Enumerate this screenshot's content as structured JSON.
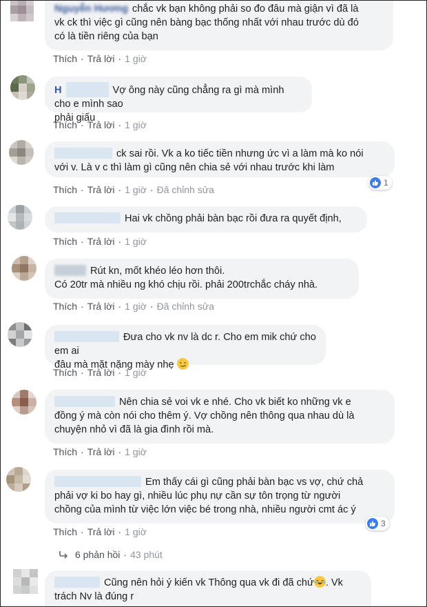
{
  "actions": {
    "like": "Thích",
    "reply": "Trả lời",
    "dot": "·",
    "edited": "Đã chỉnh sửa"
  },
  "comments": [
    {
      "name": "Nguyễn Hương",
      "lines": [
        "chắc vk bạn không phải so đo đâu mà giận vì đã là",
        "vk ck thì việc gì cũng nên bàng bạc thống nhất với nhau trước dù đó",
        "có là tiền riêng của bạn"
      ],
      "time": "1 giờ"
    },
    {
      "name": "H",
      "lines": [
        "Vợ ông này cũng chẳng ra gì mà mình cho e mình sao",
        "phải giấu"
      ],
      "time": "1 giờ"
    },
    {
      "lines": [
        "ck sai rồi. Vk a ko tiếc tiền nhưng ức vì a làm mà ko nói",
        "với v. Là v c thì làm gì cũng nên chia sẻ với nhau trước khi làm"
      ],
      "time": "1 giờ",
      "reaction_count": "1"
    },
    {
      "lines": [
        "Hai vk chồng phải bàn bạc rồi đưa ra quyết định,"
      ],
      "time": "1 giờ"
    },
    {
      "lines": [
        "Rút kn, mốt khéo léo hơn thôi.",
        "Có 20tr mà nhiều ng khó chịu rồi. phải 200trchắc cháy nhà."
      ],
      "time": "1 giờ"
    },
    {
      "lines": [
        "Đưa cho vk nv là dc r. Cho em mik chứ cho em ai",
        "đâu mà mặt nặng mày nhẹ"
      ],
      "time": "1 giờ"
    },
    {
      "lines": [
        "Nên chia sẻ voi vk e nhé. Cho vk biết ko những vk e",
        "đồng ý mà còn nói cho thêm ý. Vợ chồng nên thông qua nhau dù là",
        "chuyện nhỏ vì đã là gia đình rồi mà."
      ],
      "time": "1 giờ"
    },
    {
      "lines": [
        "Em thấy cái gì cũng phải bàn bạc vs vợ, chứ chả",
        "phải vợ ki bo hay gì, nhiều lúc phụ nự cần sự tôn trọng từ người",
        "chồng của mình từ việc lớn việc bé trong nhà, nhiều người cmt ác ý"
      ],
      "time": "1 giờ",
      "reaction_count": "3"
    },
    {
      "lines": [
        "Cũng nên hỏi ý kiến vk Thông qua vk đi đã chứ",
        "trách Nv là đúng r"
      ],
      "trail": ". Vk"
    }
  ],
  "replies": {
    "count_label": "6 phản hồi",
    "time": "43 phút"
  },
  "colors": {
    "bubble": "#f2f3f5",
    "link": "#385898",
    "like_blue": "#3b7ded"
  }
}
